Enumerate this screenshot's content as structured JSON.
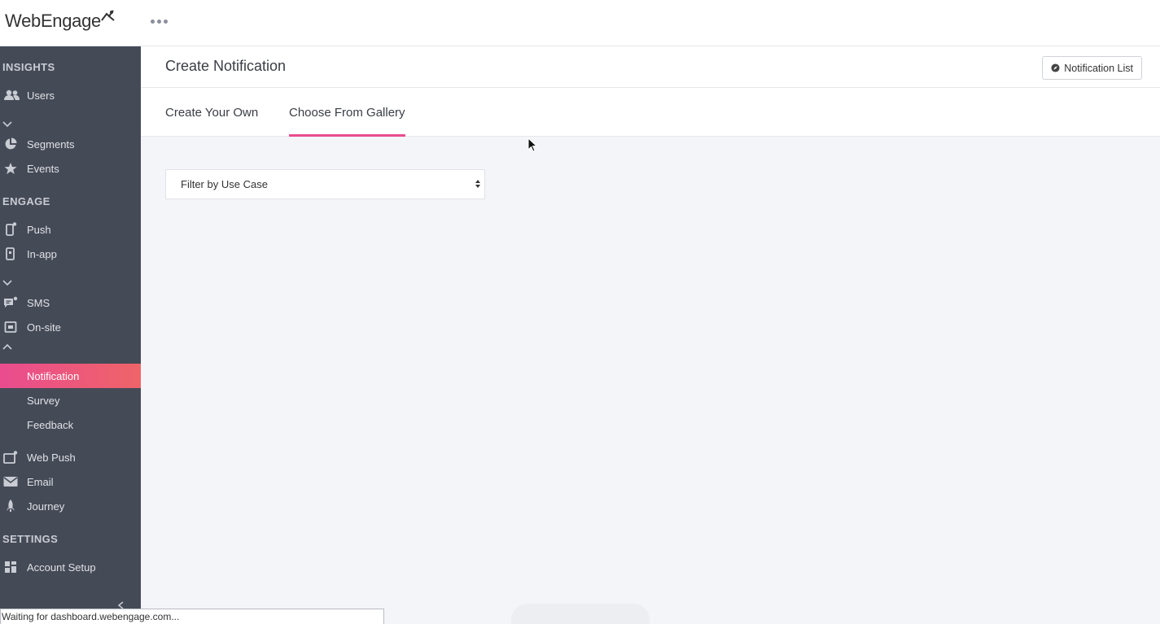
{
  "app": {
    "logo_text": "WebEngage",
    "more_menu_icon": "more-dots-icon"
  },
  "sidebar": {
    "sections": {
      "insights": "INSIGHTS",
      "engage": "ENGAGE",
      "settings": "SETTINGS"
    },
    "items": {
      "users": {
        "label": "Users",
        "icon": "users-icon"
      },
      "segments": {
        "label": "Segments",
        "icon": "pie-chart-icon"
      },
      "events": {
        "label": "Events",
        "icon": "star-icon"
      },
      "push": {
        "label": "Push",
        "icon": "mobile-icon"
      },
      "inapp": {
        "label": "In-app",
        "icon": "mobile-square-icon"
      },
      "sms": {
        "label": "SMS",
        "icon": "chat-icon"
      },
      "onsite": {
        "label": "On-site",
        "icon": "window-icon"
      },
      "notification": {
        "label": "Notification"
      },
      "survey": {
        "label": "Survey"
      },
      "feedback": {
        "label": "Feedback"
      },
      "webpush": {
        "label": "Web Push",
        "icon": "browser-icon"
      },
      "email": {
        "label": "Email",
        "icon": "envelope-icon"
      },
      "journey": {
        "label": "Journey",
        "icon": "rocket-icon"
      },
      "account_setup": {
        "label": "Account Setup",
        "icon": "grid-icon"
      }
    }
  },
  "page": {
    "title": "Create Notification",
    "notification_list_button": "Notification List",
    "tabs": [
      {
        "label": "Create Your Own",
        "active": false
      },
      {
        "label": "Choose From Gallery",
        "active": true
      }
    ],
    "filter": {
      "selected": "Filter by Use Case"
    }
  },
  "status": {
    "text": "Waiting for dashboard.webengage.com..."
  },
  "colors": {
    "sidebar_bg": "#454a57",
    "active_gradient_start": "#ea4c8f",
    "active_gradient_end": "#ef6468",
    "tab_underline": "#e84c8f",
    "main_bg": "#f4f5f9"
  }
}
